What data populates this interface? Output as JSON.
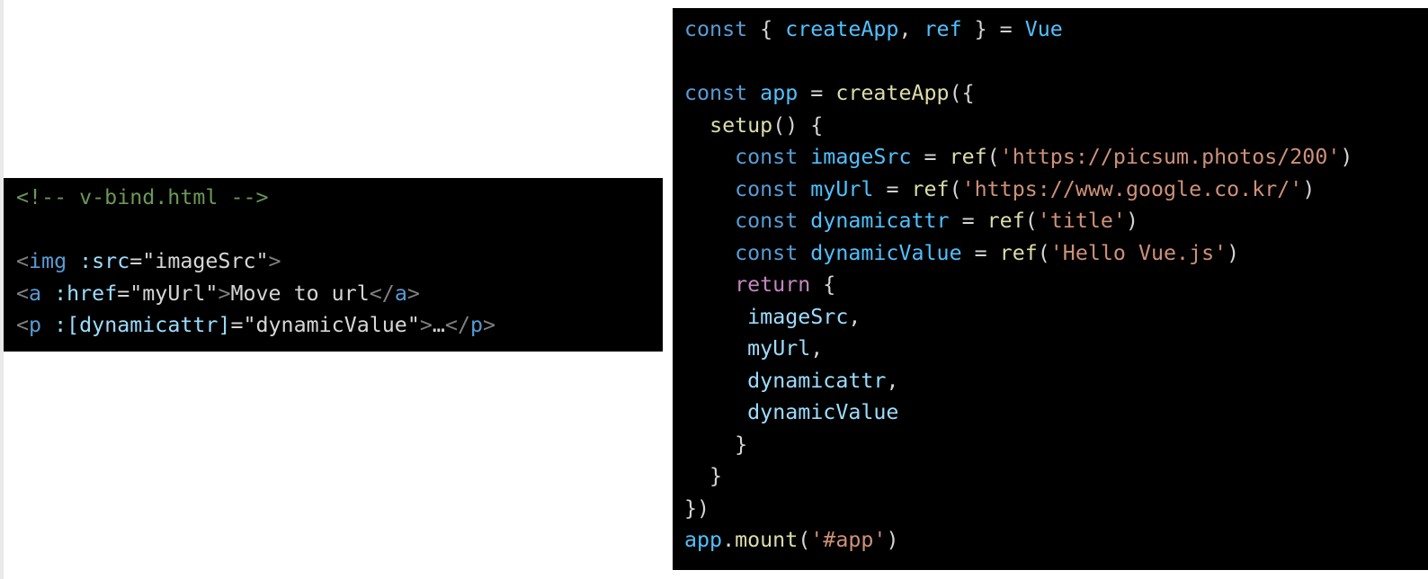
{
  "html_snippet": {
    "comment": "<!-- v-bind.html -->",
    "img_line": {
      "open": "<",
      "tag": "img",
      "attr": " :src",
      "eq": "=",
      "value": "\"imageSrc\"",
      "close": ">"
    },
    "a_line": {
      "open": "<",
      "tag": "a",
      "attr": " :href",
      "eq": "=",
      "value": "\"myUrl\"",
      "close": ">",
      "text": "Move to url",
      "end_open": "</",
      "end_tag": "a",
      "end_close": ">"
    },
    "p_line": {
      "open": "<",
      "tag": "p",
      "attr": " :[dynamicattr]",
      "eq": "=",
      "value": "\"dynamicValue\"",
      "close": ">",
      "text": "…",
      "end_open": "</",
      "end_tag": "p",
      "end_close": ">"
    }
  },
  "js_snippet": {
    "l1": {
      "kw": "const",
      "p1": " { ",
      "a": "createApp",
      "p2": ", ",
      "b": "ref",
      "p3": " } = ",
      "c": "Vue"
    },
    "l3": {
      "kw": "const",
      "sp": " ",
      "var": "app",
      "eq": " = ",
      "fn": "createApp",
      "rest": "({"
    },
    "l4": {
      "indent": "  ",
      "fn": "setup",
      "rest": "() {"
    },
    "l5": {
      "indent": "    ",
      "kw": "const",
      "sp": " ",
      "var": "imageSrc",
      "eq": " = ",
      "fn": "ref",
      "open": "(",
      "str": "'https://picsum.photos/200'",
      "close": ")"
    },
    "l6": {
      "indent": "    ",
      "kw": "const",
      "sp": " ",
      "var": "myUrl",
      "eq": " = ",
      "fn": "ref",
      "open": "(",
      "str": "'https://www.google.co.kr/'",
      "close": ")"
    },
    "l7": {
      "indent": "    ",
      "kw": "const",
      "sp": " ",
      "var": "dynamicattr",
      "eq": " = ",
      "fn": "ref",
      "open": "(",
      "str": "'title'",
      "close": ")"
    },
    "l8": {
      "indent": "    ",
      "kw": "const",
      "sp": " ",
      "var": "dynamicValue",
      "eq": " = ",
      "fn": "ref",
      "open": "(",
      "str": "'Hello Vue.js'",
      "close": ")"
    },
    "l9": {
      "indent": "    ",
      "kw": "return",
      "rest": " {"
    },
    "l10": {
      "indent": "     ",
      "prop": "imageSrc",
      "rest": ","
    },
    "l11": {
      "indent": "     ",
      "prop": "myUrl",
      "rest": ","
    },
    "l12": {
      "indent": "     ",
      "prop": "dynamicattr",
      "rest": ","
    },
    "l13": {
      "indent": "     ",
      "prop": "dynamicValue"
    },
    "l14": {
      "text": "    }"
    },
    "l15": {
      "text": "  }"
    },
    "l16": {
      "text": "})"
    },
    "l17": {
      "obj": "app",
      "dot": ".",
      "fn": "mount",
      "open": "(",
      "str": "'#app'",
      "close": ")"
    }
  }
}
